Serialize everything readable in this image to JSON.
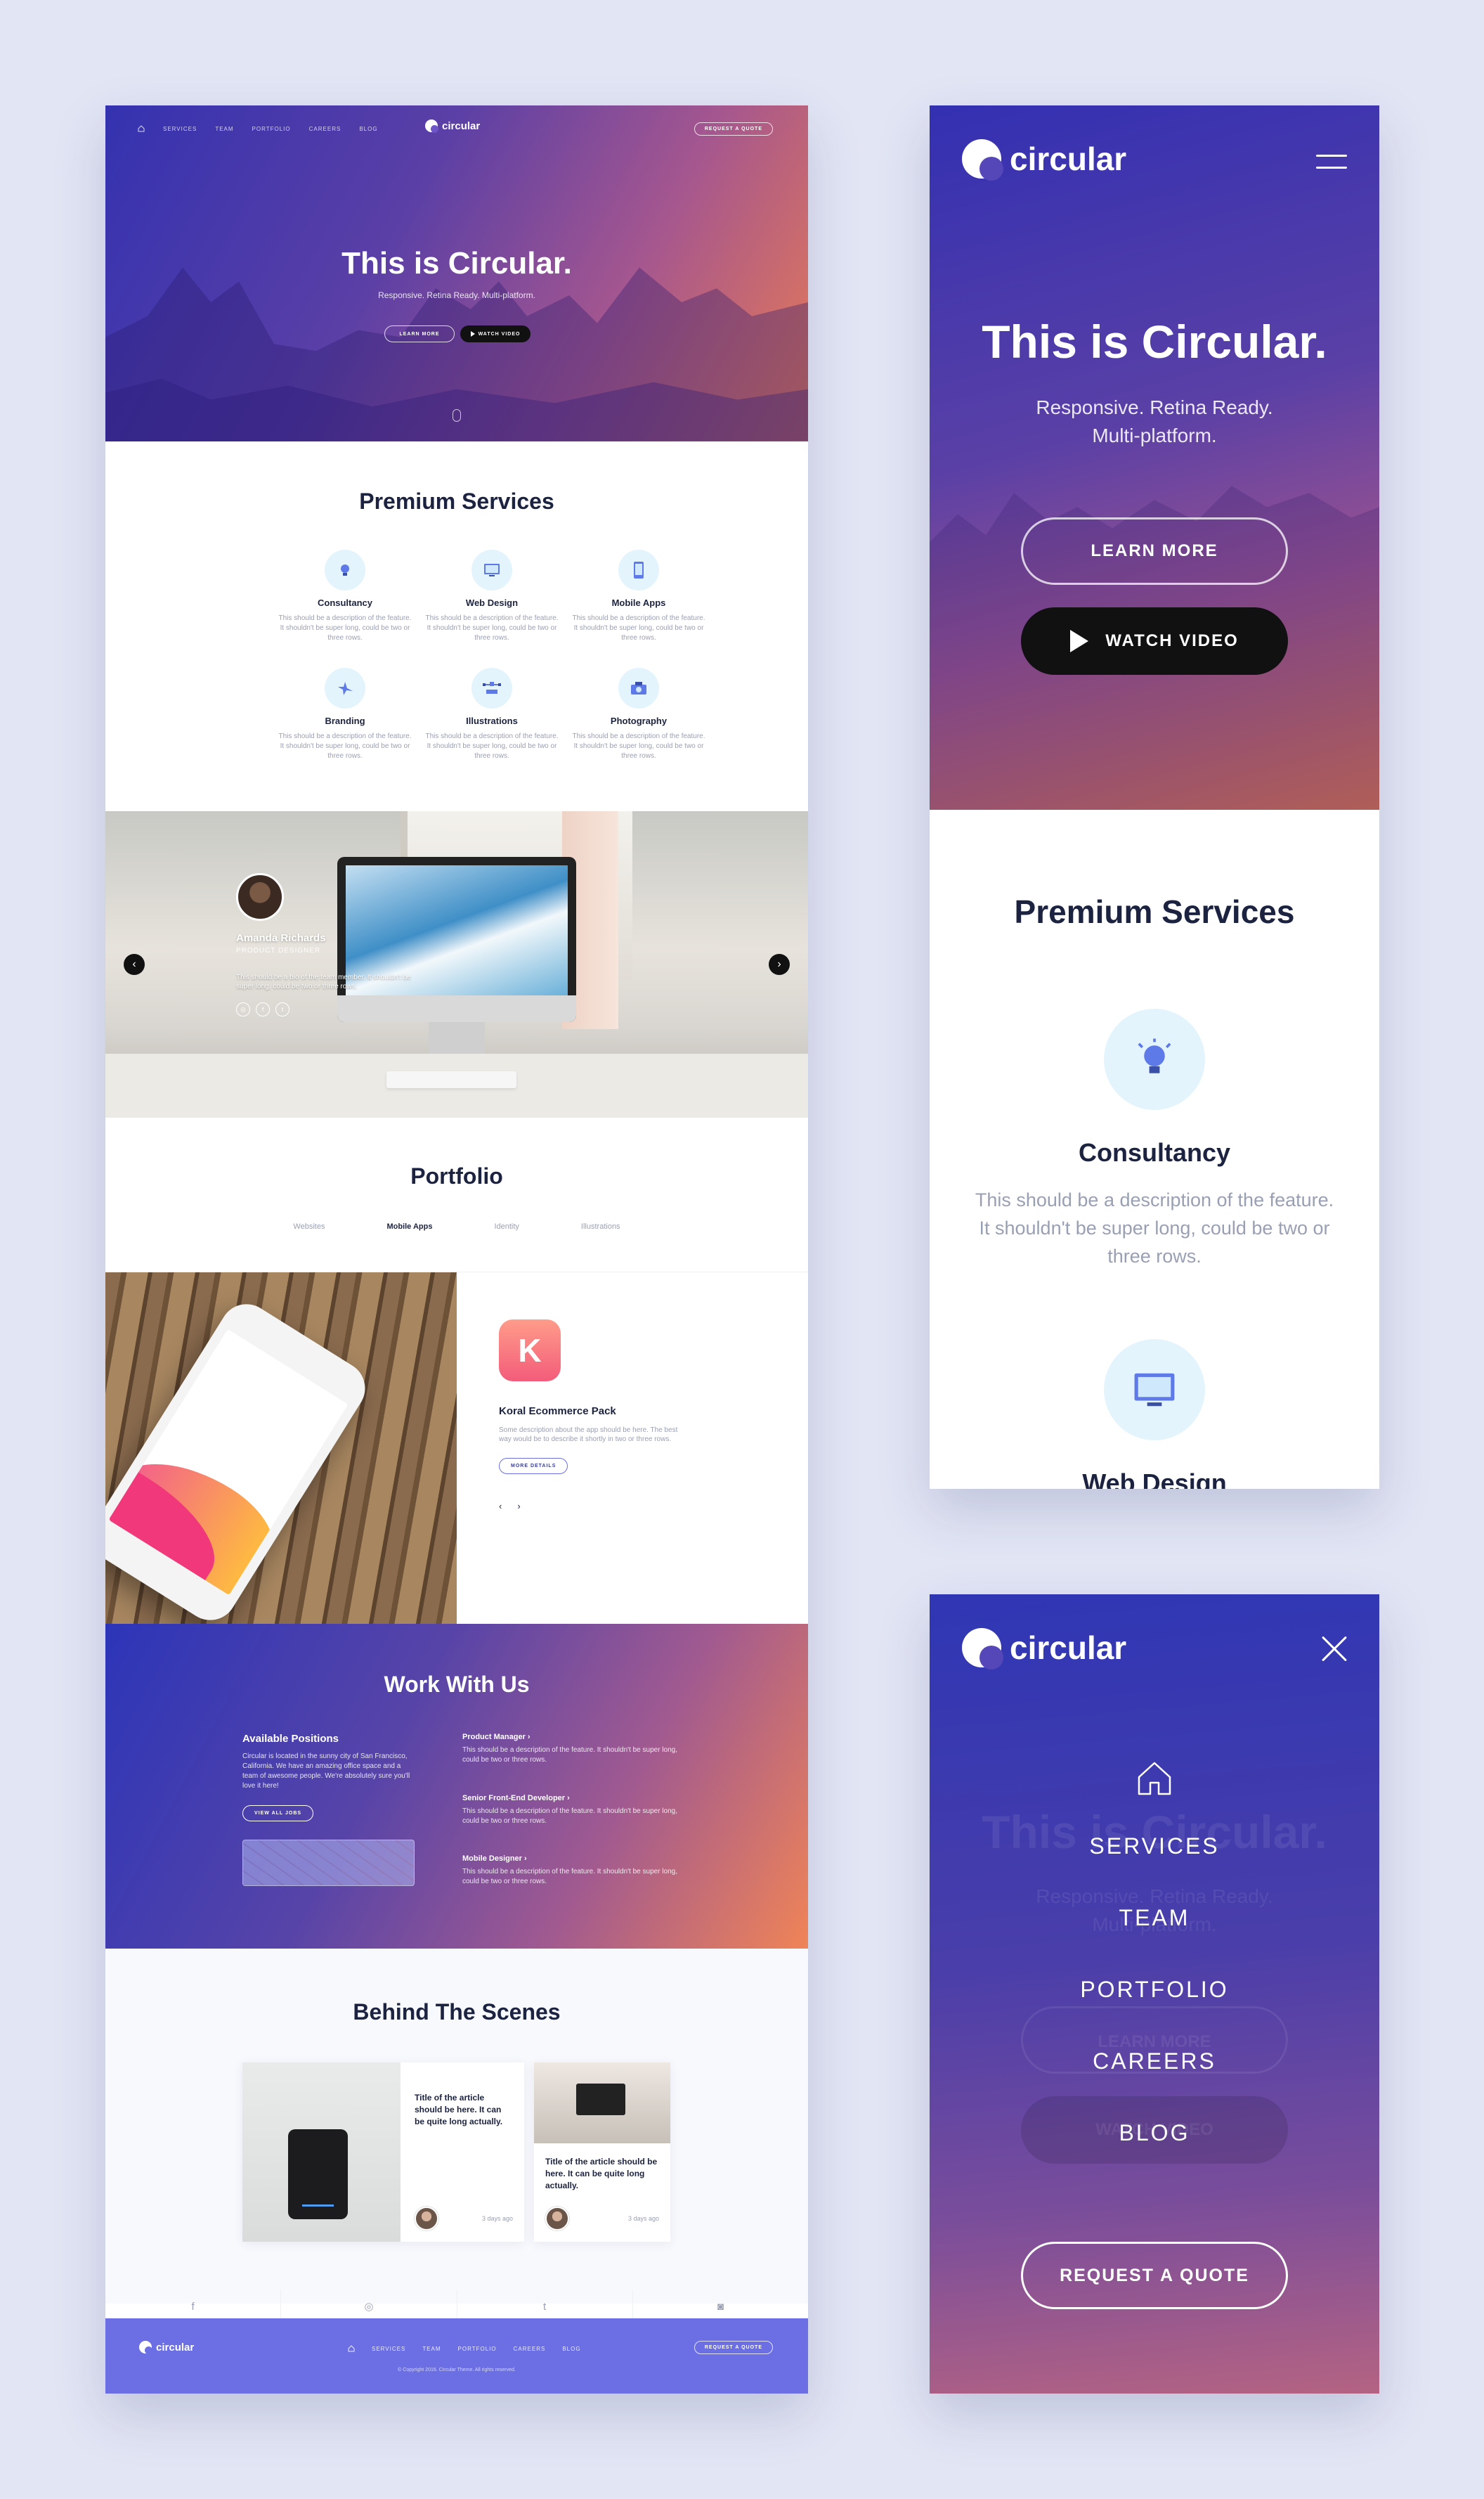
{
  "desktop": {
    "nav": {
      "items": [
        "Services",
        "Team",
        "Portfolio",
        "Careers",
        "Blog"
      ],
      "brand": "circular",
      "quote_label": "Request a quote"
    },
    "hero": {
      "title": "This is Circular.",
      "subtitle": "Responsive. Retina Ready. Multi-platform.",
      "learn_label": "Learn more",
      "watch_label": "Watch video"
    },
    "services": {
      "title": "Premium Services",
      "items": [
        {
          "name": "Consultancy",
          "desc": "This should be a description of the feature. It shouldn't be super long, could be two or three rows.",
          "icon": "lightbulb-icon"
        },
        {
          "name": "Web Design",
          "desc": "This should be a description of the feature. It shouldn't be super long, could be two or three rows.",
          "icon": "monitor-icon"
        },
        {
          "name": "Mobile Apps",
          "desc": "This should be a description of the feature. It shouldn't be super long, could be two or three rows.",
          "icon": "phone-icon"
        },
        {
          "name": "Branding",
          "desc": "This should be a description of the feature. It shouldn't be super long, could be two or three rows.",
          "icon": "branding-icon"
        },
        {
          "name": "Illustrations",
          "desc": "This should be a description of the feature. It shouldn't be super long, could be two or three rows.",
          "icon": "vector-icon"
        },
        {
          "name": "Photography",
          "desc": "This should be a description of the feature. It shouldn't be super long, could be two or three rows.",
          "icon": "camera-icon"
        }
      ]
    },
    "team": {
      "name": "Amanda Richards",
      "role": "Product Designer",
      "bio": "This should be a bio of the team member. It shouldn't be super long, could be two or three rows."
    },
    "portfolio": {
      "title": "Portfolio",
      "tabs": [
        "Websites",
        "Mobile Apps",
        "Identity",
        "Illustrations"
      ],
      "active_tab": "Mobile Apps",
      "item": {
        "app_letter": "K",
        "name": "Koral Ecommerce Pack",
        "desc": "Some description about the app should be here. The best way would be to describe it shortly in two or three rows.",
        "button_label": "More details"
      }
    },
    "work": {
      "title": "Work With Us",
      "available_title": "Available Positions",
      "available_desc": "Circular is located in the sunny city of San Francisco, California. We have an amazing office space and a team of awesome people. We're absolutely sure you'll love it here!",
      "jobs_button": "View all jobs",
      "jobs": [
        {
          "title": "Product Manager",
          "desc": "This should be a description of the feature. It shouldn't be super long, could be two or three rows."
        },
        {
          "title": "Senior Front-End Developer",
          "desc": "This should be a description of the feature. It shouldn't be super long, could be two or three rows."
        },
        {
          "title": "Mobile Designer",
          "desc": "This should be a description of the feature. It shouldn't be super long, could be two or three rows."
        }
      ]
    },
    "blog": {
      "title": "Behind The Scenes",
      "articles": [
        {
          "title": "Title of the article should be here. It can be quite long actually.",
          "ago": "3 days ago"
        },
        {
          "title": "Title of the article should be here. It can be quite long actually.",
          "ago": "3 days ago"
        }
      ]
    },
    "footer": {
      "brand": "circular",
      "nav": [
        "Services",
        "Team",
        "Portfolio",
        "Careers",
        "Blog"
      ],
      "quote_label": "Request a quote",
      "copyright": "© Copyright 2016. Circular Theme. All rights reserved."
    }
  },
  "mobile_home": {
    "brand": "circular",
    "hero_title": "This is Circular.",
    "hero_subtitle": "Responsive. Retina Ready. Multi-platform.",
    "learn_label": "Learn more",
    "watch_label": "Watch video",
    "services_title": "Premium Services",
    "services": [
      {
        "name": "Consultancy",
        "desc": "This should be a description of the feature. It shouldn't be super long, could be two or three rows."
      },
      {
        "name": "Web Design"
      }
    ]
  },
  "mobile_menu": {
    "brand": "circular",
    "ghost_title": "This is Circular.",
    "ghost_subtitle": "Responsive. Retina Ready. Multi-platform.",
    "ghost_learn": "Learn more",
    "ghost_watch": "Watch video",
    "items": [
      "Services",
      "Team",
      "Portfolio",
      "Careers",
      "Blog"
    ],
    "quote_label": "Request a quote"
  },
  "colors": {
    "accent": "#6b6fe3",
    "dark_text": "#1c2340",
    "muted_text": "#9aa0b3",
    "icon_bg": "#e3f4fd"
  }
}
